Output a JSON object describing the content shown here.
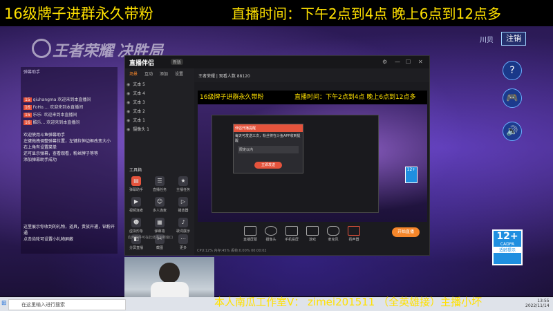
{
  "banner": {
    "left": "16级牌子进群永久带粉",
    "right": "直播时间：下午2点到4点 晚上6点到12点多"
  },
  "game": {
    "logo_left": "王者荣耀",
    "logo_right": "决胜局",
    "login": "注销",
    "region": "川贝",
    "side_btn1": "?",
    "side_btn2": "❓",
    "side_btn3": "🔊",
    "cadpa": {
      "age": "12+",
      "brand": "CADPA",
      "note": "适龄提示"
    }
  },
  "chat": {
    "header": "弹幕助手",
    "rows": [
      {
        "badge": "15",
        "text": "qiuhangma 欢迎来到本直播间"
      },
      {
        "badge": "16",
        "text": "FoHo.... 欢迎来到本直播间"
      },
      {
        "badge": "15",
        "text": "乐乐:  欢迎来到本直播间"
      },
      {
        "badge": "16",
        "text": "酷乐... 欢迎来到本直播间"
      }
    ],
    "tips": "欢迎使用斗鱼弹幕助手\n左键拖拽调整弹幕位置，左键拉伸边框改变大小\n右上角有设置菜单\n还可显示弹幕，查看观看，粉丝牌子等等\n添加弹幕助手成功",
    "gift_tip": "这里展示你收到的礼物，道具，贵族开通，钻粉开通\n点击齿轮可设置小礼物屏蔽"
  },
  "app": {
    "title": "直播伴侣",
    "version": "新版",
    "tabs": [
      "场景",
      "互动",
      "添加",
      "设置"
    ],
    "scenes": [
      "文本 5",
      "文本 4",
      "文本 3",
      "文本 2",
      "文本 1",
      "摄像头 1"
    ],
    "tools_title": "工具箱",
    "tools": [
      {
        "label": "弹幕助手",
        "icon": "danmu-icon"
      },
      {
        "label": "直播任务",
        "icon": "task-icon"
      },
      {
        "label": "主播任务",
        "icon": "anchor-task-icon"
      },
      {
        "label": "视频连麦",
        "icon": "video-call-icon"
      },
      {
        "label": "多人连麦",
        "icon": "multi-call-icon"
      },
      {
        "label": "播放器",
        "icon": "player-icon"
      },
      {
        "label": "虚拟形象",
        "icon": "avatar-icon"
      },
      {
        "label": "弹幕墙",
        "icon": "wall-icon"
      },
      {
        "label": "歌词展示",
        "icon": "lyrics-icon"
      },
      {
        "label": "分屏直播",
        "icon": "split-icon"
      },
      {
        "label": "截图",
        "icon": "screenshot-icon"
      },
      {
        "label": "更多",
        "icon": "more-icon"
      }
    ],
    "topbar": "王者荣耀 | 观看人数 88120",
    "preview_left": "16级牌子进群永久带粉",
    "preview_right": "直播时间：下午2点到4点 晚上6点到12点多",
    "dialog": {
      "title": "伴侣开播提醒",
      "body": "每天可发送三次，粉丝将在斗鱼APP收到提醒",
      "input_placeholder": "限定以内",
      "button": "立即发送"
    },
    "bottom": [
      "直播屏幕",
      "摄像头",
      "手机投屏",
      "游戏",
      "麦克风",
      "扬声器"
    ],
    "start_btn": "开始直播",
    "status": "CPU:12%  内存:45%  丢帧:0.00%  00:00:02",
    "footer": "应用软件可在此处添加新窗口"
  },
  "taskbar": {
    "search": "在这里输入进行搜索",
    "time": "13:55",
    "date": "2022/11/14"
  },
  "ticker": "本人南瓜工作室V：  zimei201511  （全英雄接）主播小坏"
}
